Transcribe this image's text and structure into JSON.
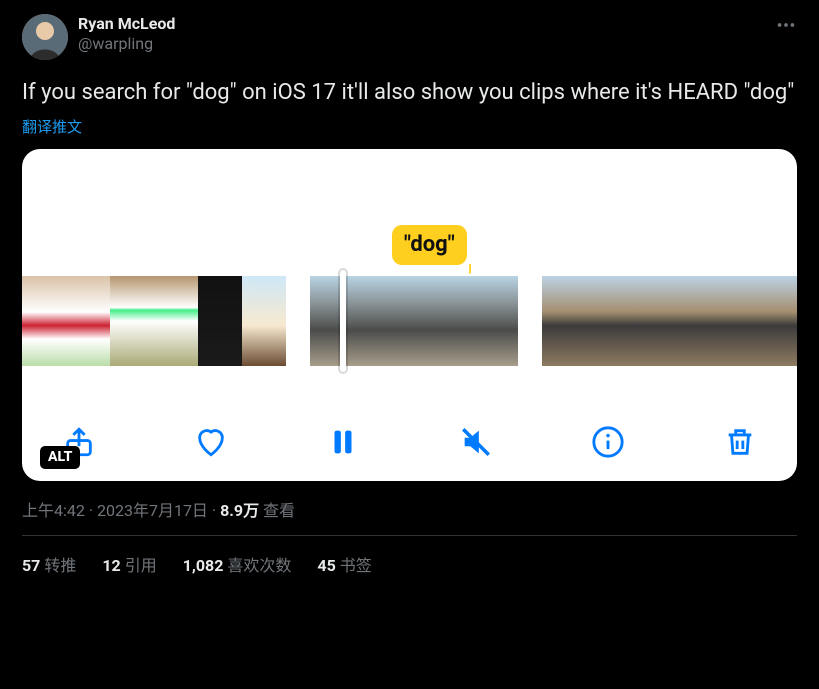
{
  "author": {
    "display_name": "Ryan McLeod",
    "handle": "@warpling"
  },
  "tweet_text": "If you search for \"dog\" on iOS 17 it'll also show you clips where it's HEARD \"dog\"",
  "translate_label": "翻译推文",
  "media": {
    "alt_badge": "ALT",
    "search_bubble": "\"dog\""
  },
  "timestamp": {
    "time": "上午4:42",
    "date": "2023年7月17日",
    "views_number": "8.9万",
    "views_label": "查看"
  },
  "stats": {
    "retweets": {
      "count": "57",
      "label": "转推"
    },
    "quotes": {
      "count": "12",
      "label": "引用"
    },
    "likes": {
      "count": "1,082",
      "label": "喜欢次数"
    },
    "bookmarks": {
      "count": "45",
      "label": "书签"
    }
  }
}
